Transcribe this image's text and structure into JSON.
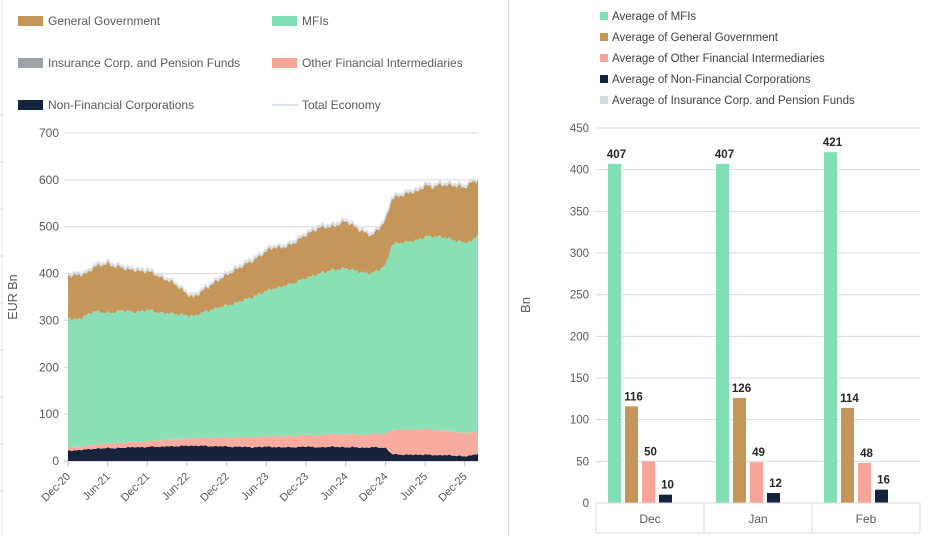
{
  "chart_data": [
    {
      "type": "area",
      "title": "",
      "ylabel": "EUR Bn",
      "xlabel": "",
      "ylim": [
        0,
        700
      ],
      "y_ticks": [
        0,
        100,
        200,
        300,
        400,
        500,
        600,
        700
      ],
      "grid": true,
      "x_tick_labels": [
        "Dec-20",
        "Jun-21",
        "Dec-21",
        "Jun-22",
        "Dec-22",
        "Jun-23",
        "Dec-23",
        "Jun-24",
        "Dec-24",
        "Jun-25",
        "Dec-25"
      ],
      "x_tick_every_n_points": 6,
      "n_points": 63,
      "x_range_note": "monthly estimates Dec-2020 through Feb-2026, values estimated from pixels",
      "stack_order_bottom_to_top": [
        "Non-Financial Corporations",
        "Other Financial Intermediaries",
        "MFIs",
        "General Government",
        "Insurance Corp. and Pension Funds"
      ],
      "series": [
        {
          "name": "Non-Financial Corporations",
          "color": "#16233b",
          "values": [
            23,
            22,
            24,
            25,
            26,
            27,
            28,
            27,
            28,
            29,
            30,
            29,
            30,
            31,
            30,
            32,
            31,
            32,
            33,
            32,
            33,
            32,
            31,
            32,
            31,
            30,
            31,
            30,
            29,
            30,
            31,
            30,
            29,
            30,
            29,
            30,
            31,
            30,
            29,
            30,
            31,
            30,
            29,
            30,
            29,
            28,
            30,
            29,
            28,
            15,
            14,
            13,
            14,
            13,
            14,
            13,
            12,
            13,
            12,
            11,
            10,
            12,
            16
          ]
        },
        {
          "name": "Other Financial Intermediaries",
          "color": "#f8aca0",
          "values": [
            6,
            7,
            7,
            8,
            9,
            9,
            10,
            10,
            11,
            11,
            12,
            12,
            13,
            13,
            14,
            14,
            15,
            15,
            16,
            17,
            17,
            18,
            18,
            19,
            19,
            20,
            20,
            21,
            21,
            22,
            22,
            23,
            23,
            24,
            24,
            25,
            25,
            25,
            26,
            26,
            27,
            27,
            28,
            28,
            27,
            28,
            29,
            29,
            30,
            52,
            53,
            54,
            53,
            54,
            55,
            54,
            53,
            52,
            51,
            50,
            50,
            49,
            48
          ]
        },
        {
          "name": "MFIs",
          "color": "#8bdfb4",
          "values": [
            277,
            272,
            275,
            280,
            285,
            282,
            278,
            280,
            283,
            280,
            276,
            278,
            280,
            276,
            272,
            270,
            268,
            266,
            262,
            260,
            265,
            270,
            275,
            278,
            282,
            285,
            290,
            295,
            300,
            305,
            310,
            315,
            318,
            322,
            326,
            330,
            335,
            340,
            345,
            348,
            350,
            352,
            355,
            350,
            348,
            345,
            342,
            350,
            360,
            395,
            398,
            400,
            402,
            405,
            410,
            412,
            414,
            412,
            410,
            408,
            407,
            407,
            421
          ]
        },
        {
          "name": "General Government",
          "color": "#c49659",
          "values": [
            90,
            95,
            92,
            88,
            95,
            100,
            105,
            98,
            92,
            88,
            90,
            85,
            82,
            80,
            75,
            70,
            65,
            55,
            45,
            40,
            45,
            50,
            55,
            60,
            65,
            70,
            72,
            75,
            78,
            80,
            85,
            88,
            85,
            82,
            85,
            88,
            92,
            95,
            98,
            95,
            92,
            96,
            100,
            95,
            90,
            85,
            80,
            88,
            95,
            98,
            100,
            102,
            105,
            103,
            110,
            105,
            110,
            112,
            115,
            118,
            116,
            126,
            114
          ]
        },
        {
          "name": "Insurance Corp. and Pension Funds",
          "color": "#c9d3d8",
          "values": [
            2,
            2,
            2,
            2,
            2,
            2,
            2,
            2,
            2,
            2,
            2,
            2,
            2,
            2,
            2,
            2,
            2,
            2,
            2,
            2,
            2,
            2,
            2,
            2,
            2,
            2,
            2,
            2,
            2,
            2,
            2,
            2,
            2,
            2,
            2,
            2,
            2,
            2,
            2,
            2,
            2,
            2,
            2,
            2,
            2,
            2,
            2,
            2,
            2,
            2,
            2,
            2,
            2,
            2,
            2,
            2,
            2,
            2,
            2,
            2,
            2,
            2,
            2
          ]
        }
      ],
      "total_line": {
        "name": "Total Economy",
        "color": "#d6dee6"
      },
      "legend": [
        {
          "label": "General Government",
          "color": "#c49659",
          "shape": "swatch"
        },
        {
          "label": "MFIs",
          "color": "#82dfb5",
          "shape": "swatch"
        },
        {
          "label": "Insurance Corp. and Pension Funds",
          "color": "#9ea3a7",
          "shape": "swatch"
        },
        {
          "label": "Other Financial Intermediaries",
          "color": "#f6a497",
          "shape": "swatch"
        },
        {
          "label": "Non-Financial Corporations",
          "color": "#14243e",
          "shape": "swatch"
        },
        {
          "label": "Total Economy",
          "color": "#d6dee6",
          "shape": "line"
        }
      ],
      "colors": {
        "gridline": "#d9d9d9",
        "axis_line": "#bfbfbf",
        "tick_text": "#595959",
        "legend_text": "#595959"
      }
    },
    {
      "type": "bar",
      "title": "",
      "ylabel": "Bn",
      "xlabel": "",
      "ylim": [
        0,
        450
      ],
      "y_ticks": [
        0,
        50,
        100,
        150,
        200,
        250,
        300,
        350,
        400,
        450
      ],
      "grid": true,
      "categories": [
        "Dec",
        "Jan",
        "Feb"
      ],
      "series": [
        {
          "name": "Average of MFIs",
          "color": "#82dfb5",
          "values": [
            407,
            407,
            421
          ]
        },
        {
          "name": "Average of General Government",
          "color": "#c49659",
          "values": [
            116,
            126,
            114
          ]
        },
        {
          "name": "Average of Other Financial Intermediaries",
          "color": "#f6a497",
          "values": [
            50,
            49,
            48
          ]
        },
        {
          "name": "Average of Non-Financial Corporations",
          "color": "#14243e",
          "values": [
            10,
            12,
            16
          ]
        },
        {
          "name": "Average of Insurance Corp. and Pension Funds",
          "color": "#d3dde0",
          "values": [
            0,
            0,
            0
          ]
        }
      ],
      "data_labels_shown": true,
      "legend_position": "top",
      "colors": {
        "gridline": "#d9d9d9",
        "axis_line": "#bfbfbf",
        "tick_text": "#595959",
        "legend_text": "#404040",
        "data_label_text": "#262626",
        "category_box_border": "#d9d9d9"
      }
    }
  ]
}
